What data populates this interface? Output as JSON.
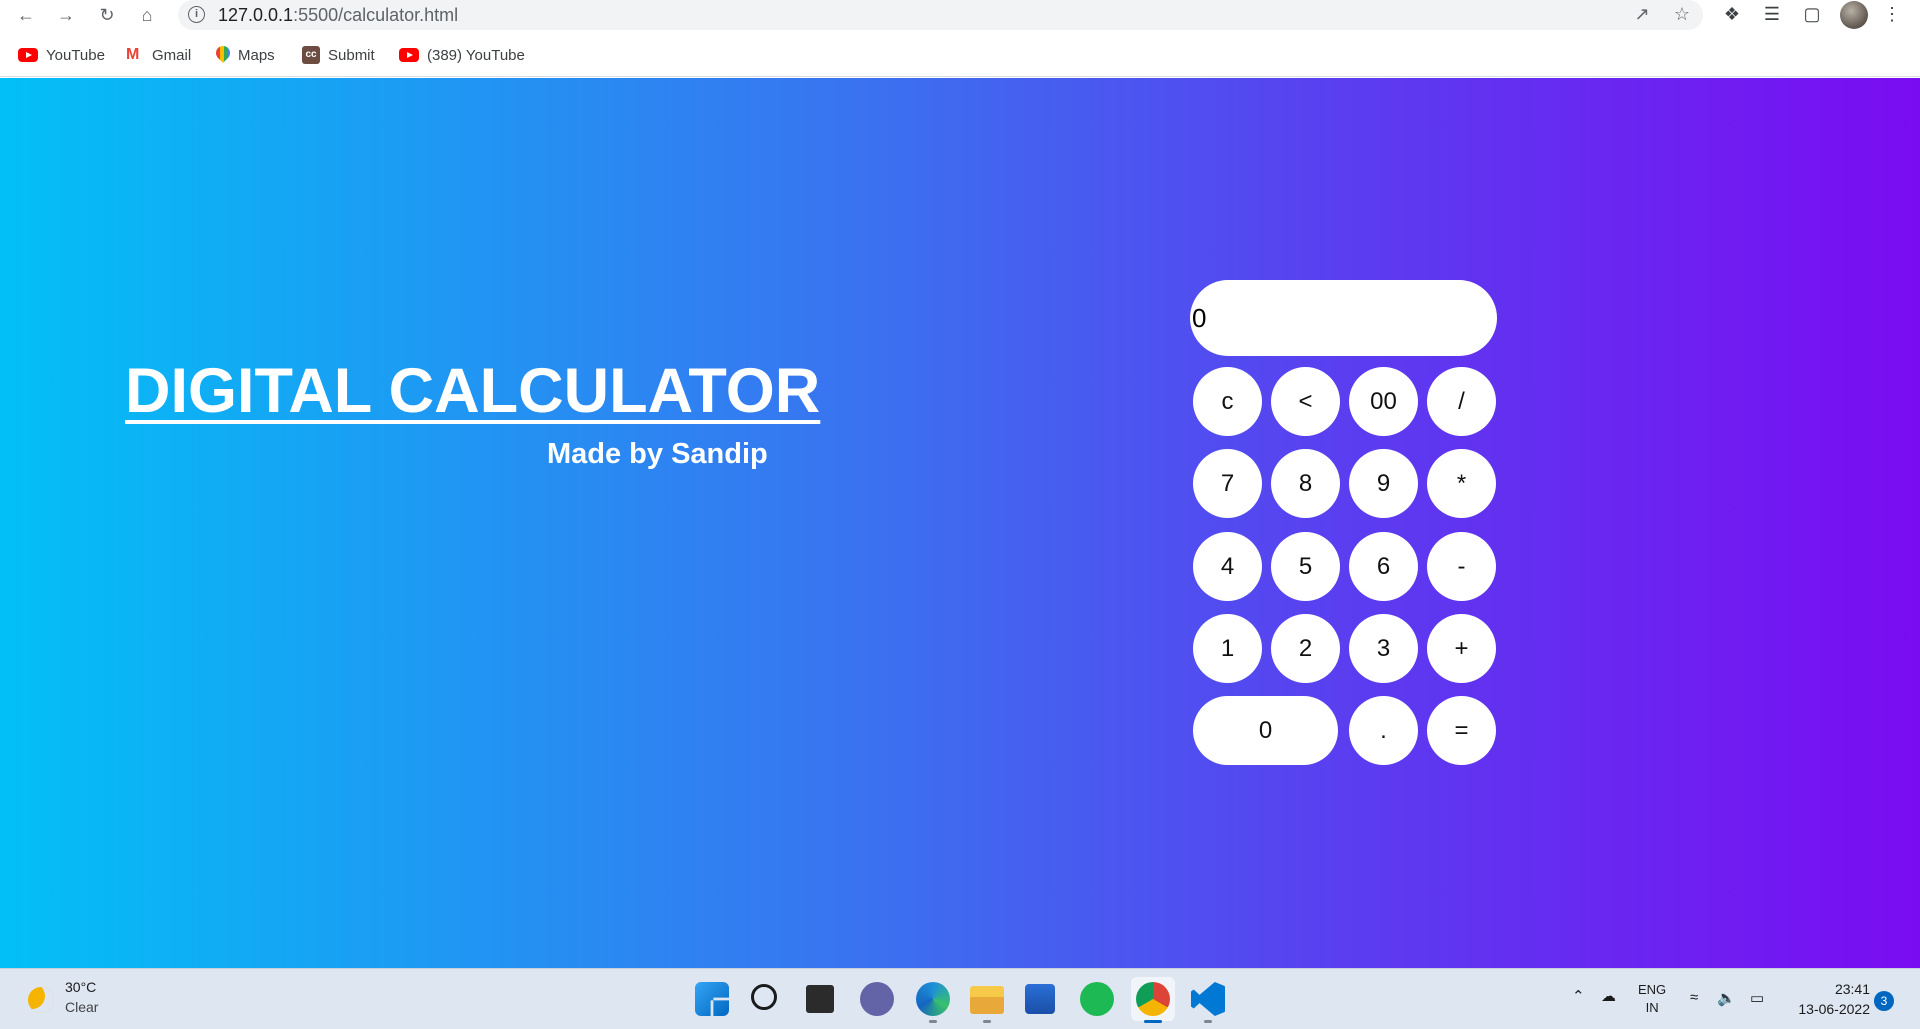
{
  "browser": {
    "url_host": "127.0.0.1",
    "url_rest": ":5500/calculator.html",
    "bookmarks": [
      {
        "label": "YouTube",
        "icon": "youtube-icon"
      },
      {
        "label": "Gmail",
        "icon": "gmail-icon"
      },
      {
        "label": "Maps",
        "icon": "maps-icon"
      },
      {
        "label": "Submit",
        "icon": "cc-icon"
      },
      {
        "label": "(389) YouTube",
        "icon": "youtube-icon"
      }
    ]
  },
  "page": {
    "title": "DIGITAL CALCULATOR",
    "subtitle": "Made by Sandip",
    "gradient": [
      "#02c0f6",
      "#3a72f0",
      "#7a0cf2"
    ]
  },
  "calculator": {
    "display_value": "0",
    "keys": [
      "c",
      "<",
      "00",
      "/",
      "7",
      "8",
      "9",
      "*",
      "4",
      "5",
      "6",
      "-",
      "1",
      "2",
      "3",
      "+",
      "0",
      ".",
      "="
    ]
  },
  "taskbar": {
    "weather_temp": "30°C",
    "weather_desc": "Clear",
    "lang_line1": "ENG",
    "lang_line2": "IN",
    "time": "23:41",
    "date": "13-06-2022",
    "notification_count": "3"
  }
}
